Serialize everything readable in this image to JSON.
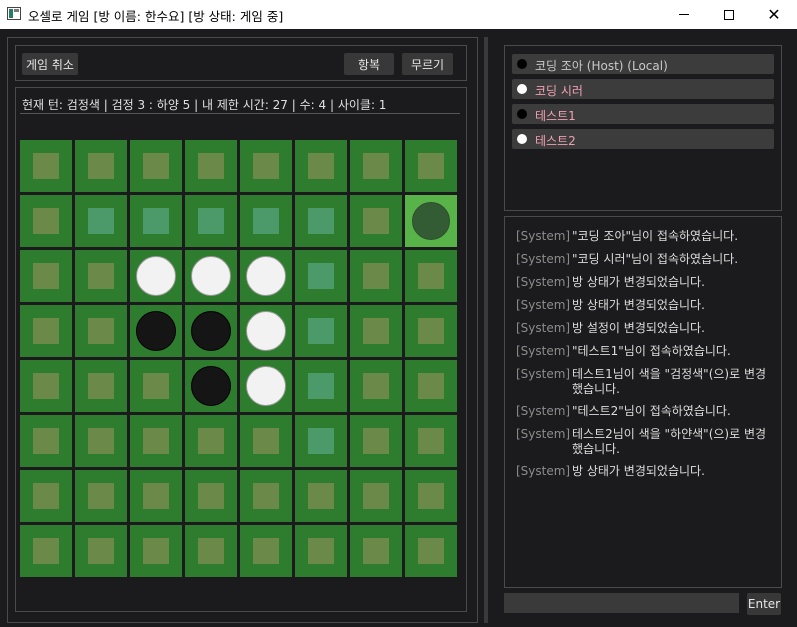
{
  "window": {
    "title": "오셀로 게임 [방 이름: 한수요] [방 상태: 게임 중]",
    "icon": "app-icon",
    "minimize_label": "",
    "maximize_label": "",
    "close_glyph": "✕"
  },
  "toolbar": {
    "cancel_game": "게임 취소",
    "surrender": "항복",
    "undo": "무르기"
  },
  "status_line": "현재 턴: 검정색 | 검정 3 : 하양 5 | 내 제한 시간: 27 | 수: 4 | 사이클: 1",
  "board": {
    "size": 8,
    "colors": {
      "cell": "#2e7d2e",
      "highlight": "#58b448",
      "marker": "#6b8a4a",
      "valid_marker": "#4c9a6a"
    },
    "rows": [
      "........",
      ".vvvvv.g",
      "..WWWv..",
      "..BBWv..",
      "...BWv..",
      ".....v..",
      "........",
      "........"
    ],
    "legend": {
      "W": "white disc",
      "B": "black disc",
      "v": "valid move marker",
      "g": "last move highlight"
    }
  },
  "players": [
    {
      "name": "코딩 조아 (Host) (Local)",
      "disc": "black",
      "name_color": "#c9c9c9"
    },
    {
      "name": "코딩 시러",
      "disc": "white",
      "name_color": "#f0a0b4"
    },
    {
      "name": "테스트1",
      "disc": "black",
      "name_color": "#f0a0b4"
    },
    {
      "name": "테스트2",
      "disc": "white",
      "name_color": "#f0a0b4"
    }
  ],
  "chat_log": [
    {
      "tag": "[System]",
      "msg": "\"코딩 조아\"님이 접속하였습니다."
    },
    {
      "tag": "[System]",
      "msg": "\"코딩 시러\"님이 접속하였습니다."
    },
    {
      "tag": "[System]",
      "msg": "방 상태가 변경되었습니다."
    },
    {
      "tag": "[System]",
      "msg": "방 상태가 변경되었습니다."
    },
    {
      "tag": "[System]",
      "msg": "방 설정이 변경되었습니다."
    },
    {
      "tag": "[System]",
      "msg": "\"테스트1\"님이 접속하였습니다."
    },
    {
      "tag": "[System]",
      "msg": "테스트1님이 색을 \"검정색\"(으)로 변경했습니다."
    },
    {
      "tag": "[System]",
      "msg": "\"테스트2\"님이 접속하였습니다."
    },
    {
      "tag": "[System]",
      "msg": "테스트2님이 색을 \"하얀색\"(으)로 변경했습니다."
    },
    {
      "tag": "[System]",
      "msg": "방 상태가 변경되었습니다."
    }
  ],
  "chat": {
    "input_value": "",
    "input_placeholder": "",
    "send_label": "Enter"
  }
}
